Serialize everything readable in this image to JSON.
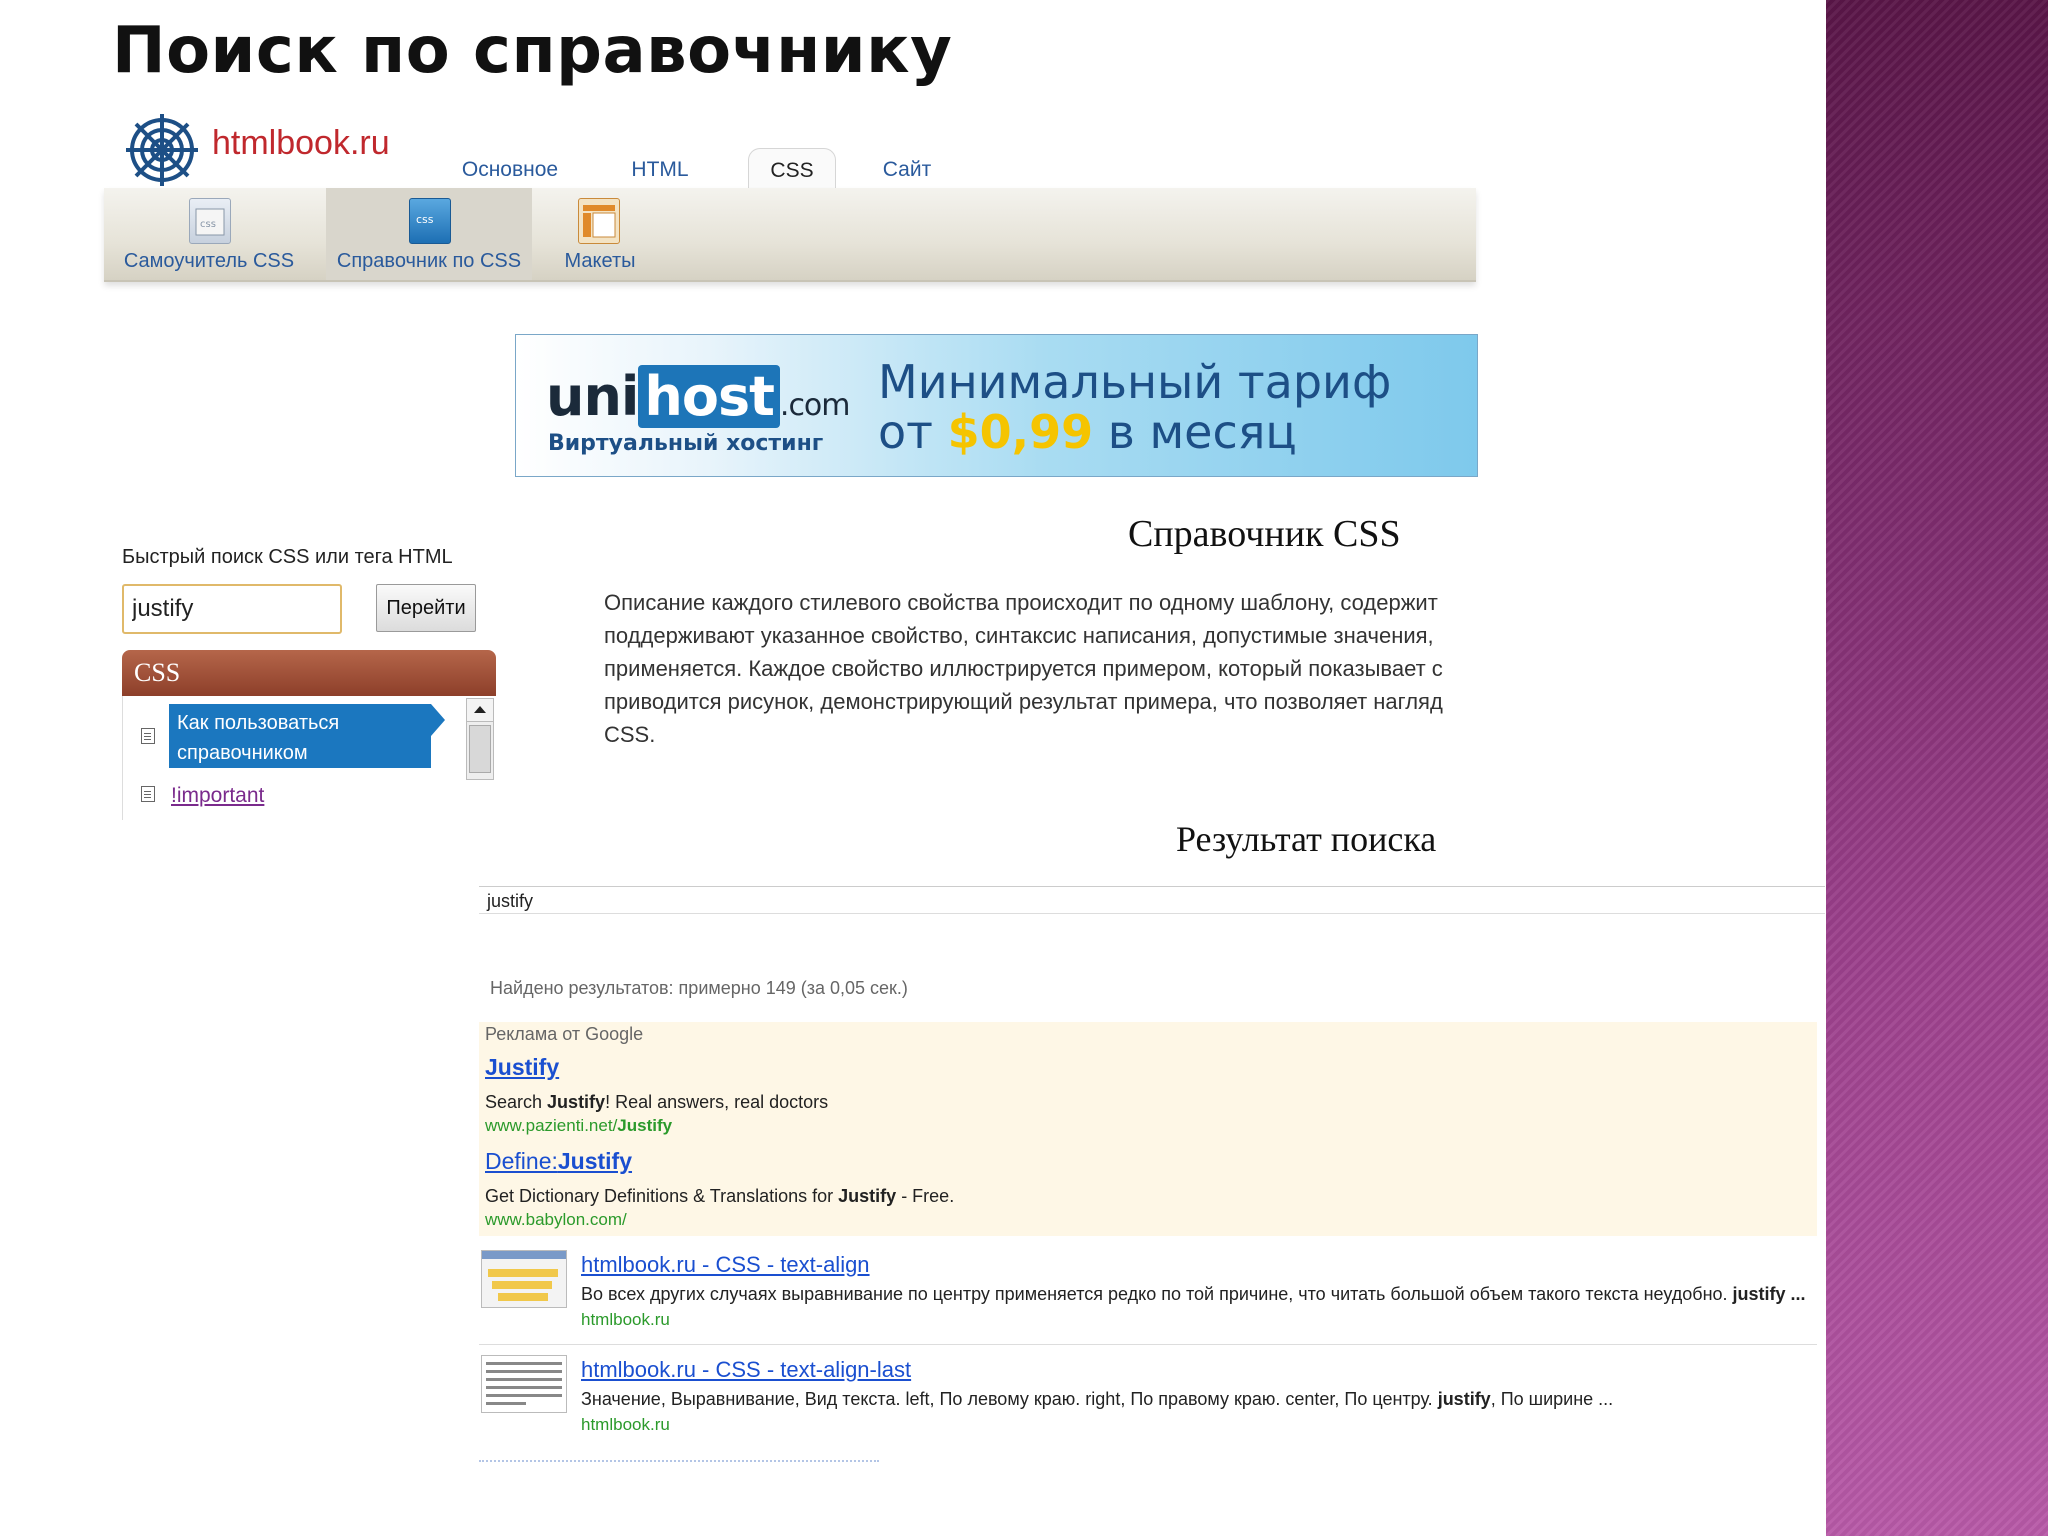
{
  "slide": {
    "title": "Поиск по справочнику"
  },
  "site": {
    "logo_text": "htmlbook.ru",
    "tabs": [
      {
        "label": "Основное"
      },
      {
        "label": "HTML"
      },
      {
        "label": "CSS"
      },
      {
        "label": "Сайт"
      }
    ],
    "toolbar": [
      {
        "label": "Самоучитель CSS",
        "icon": "css-tutorial-icon"
      },
      {
        "label": "Справочник по CSS",
        "icon": "css-reference-icon"
      },
      {
        "label": "Макеты",
        "icon": "layouts-icon"
      }
    ]
  },
  "banner": {
    "brand_uni": "uni",
    "brand_host": "host",
    "brand_domain": ".com",
    "subtitle": "Виртуальный хостинг",
    "line1": "Минимальный тариф",
    "line2_pre": "от",
    "price": "$0,99",
    "line2_post": "в месяц"
  },
  "sidebar": {
    "search_label": "Быстрый поиск CSS или тега HTML",
    "search_value": "justify",
    "go_button": "Перейти",
    "panel_title": "CSS",
    "items": [
      {
        "label": "Как пользоваться справочником"
      },
      {
        "label": "!important"
      }
    ]
  },
  "main": {
    "title": "Справочник CSS",
    "description": [
      "Описание каждого стилевого свойства происходит по одному шаблону, содержит",
      "поддерживают указанное свойство, синтаксис написания, допустимые значения,",
      "применяется. Каждое свойство иллюстрируется примером, который показывает с",
      "приводится рисунок, демонстрирующий результат примера, что позволяет нагляд",
      "CSS."
    ]
  },
  "search": {
    "title": "Результат поиска",
    "query": "justify",
    "found": "Найдено результатов: примерно 149 (за 0,05 сек.)",
    "ads_label": "Реклама от Google",
    "ads": [
      {
        "title_pre": "",
        "title_bold": "Justify",
        "text_pre": "Search ",
        "text_bold": "Justify",
        "text_post": "! Real answers, real doctors",
        "url_pre": "www.pazienti.net/",
        "url_bold": "Justify"
      },
      {
        "title_pre": "Define:",
        "title_bold": "Justify",
        "text_pre": "Get Dictionary Definitions & Translations for ",
        "text_bold": "Justify",
        "text_post": " - Free.",
        "url_pre": "www.babylon.com/",
        "url_bold": ""
      }
    ],
    "results": [
      {
        "title": "htmlbook.ru - CSS - text-align",
        "snippet_pre": "Во всех других случаях выравнивание по центру применяется редко по той причине, что читать большой объем такого текста неудобно. ",
        "snippet_bold": "justify",
        "snippet_post": " ...",
        "url": "htmlbook.ru"
      },
      {
        "title": "htmlbook.ru - CSS - text-align-last",
        "snippet_pre": "Значение, Выравнивание, Вид текста. left, По левому краю. right, По правому краю. center, По центру. ",
        "snippet_bold": "justify",
        "snippet_post": ", По ширине ...",
        "url": "htmlbook.ru"
      }
    ]
  },
  "colors": {
    "accent_link": "#1a4fd0",
    "site_red": "#c0282d",
    "panel_brown": "#8d3f2a",
    "selected_blue": "#1b77bf",
    "ads_bg": "#fef7e6",
    "url_green": "#2b9a2b"
  }
}
